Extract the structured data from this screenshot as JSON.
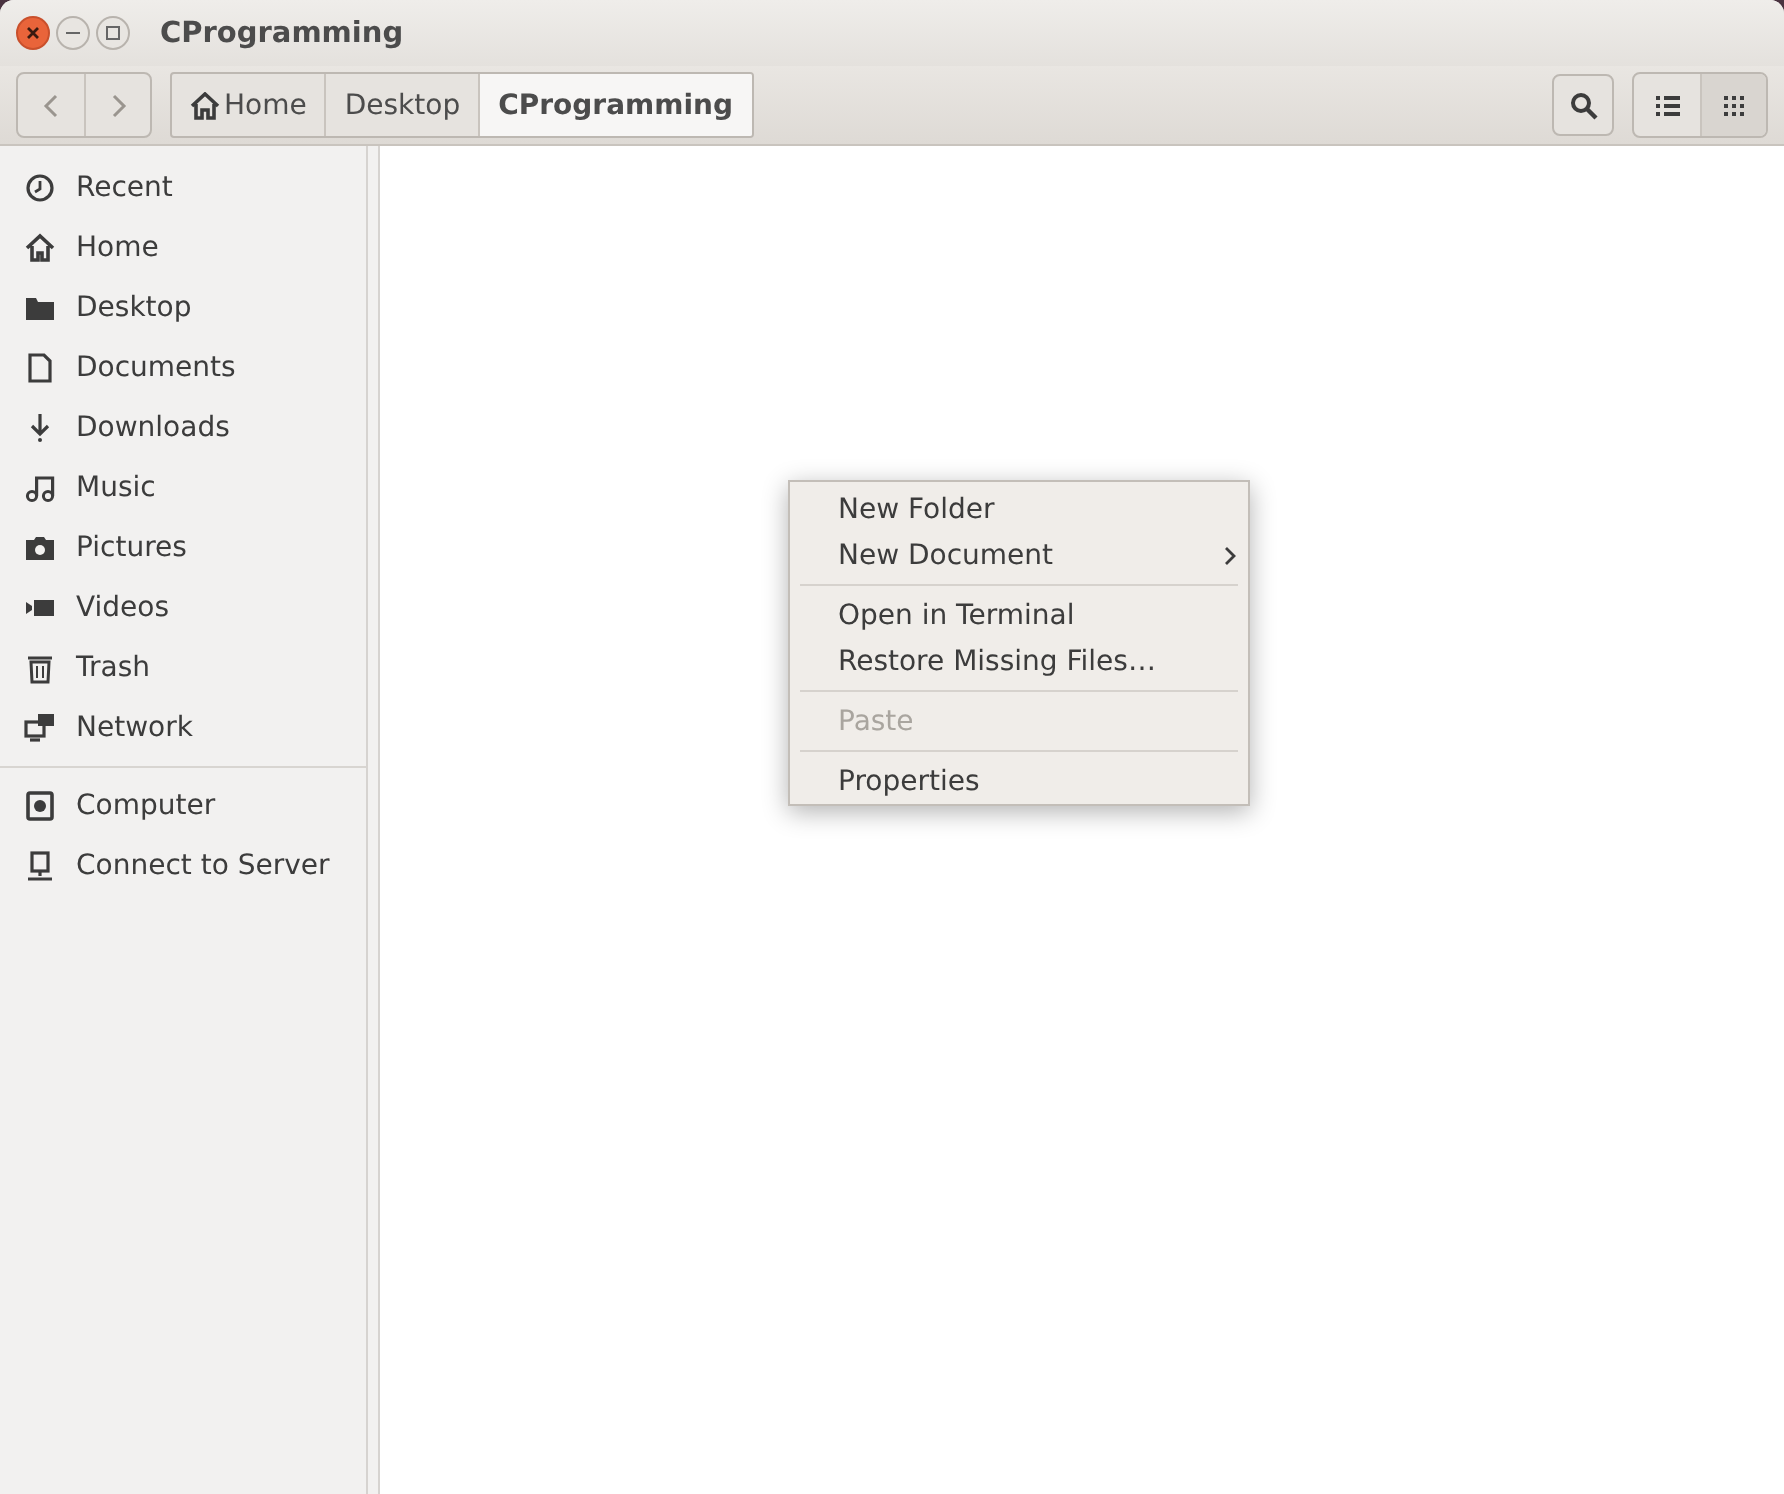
{
  "window": {
    "title": "CProgramming"
  },
  "toolbar": {
    "breadcrumbs": [
      {
        "label": "Home",
        "selected": false
      },
      {
        "label": "Desktop",
        "selected": false
      },
      {
        "label": "CProgramming",
        "selected": true
      }
    ],
    "view_buttons": [
      {
        "kind": "list",
        "selected": false
      },
      {
        "kind": "grid",
        "selected": true
      }
    ]
  },
  "sidebar": {
    "groups": [
      {
        "items": [
          {
            "label": "Recent"
          },
          {
            "label": "Home"
          },
          {
            "label": "Desktop"
          },
          {
            "label": "Documents"
          },
          {
            "label": "Downloads"
          },
          {
            "label": "Music"
          },
          {
            "label": "Pictures"
          },
          {
            "label": "Videos"
          },
          {
            "label": "Trash"
          },
          {
            "label": "Network"
          }
        ]
      },
      {
        "items": [
          {
            "label": "Computer"
          },
          {
            "label": "Connect to Server"
          }
        ]
      }
    ]
  },
  "context_menu": {
    "groups": [
      {
        "items": [
          {
            "label": "New Folder",
            "disabled": false,
            "submenu": false
          },
          {
            "label": "New Document",
            "disabled": false,
            "submenu": true
          }
        ]
      },
      {
        "items": [
          {
            "label": "Open in Terminal",
            "disabled": false,
            "submenu": false
          },
          {
            "label": "Restore Missing Files…",
            "disabled": false,
            "submenu": false
          }
        ]
      },
      {
        "items": [
          {
            "label": "Paste",
            "disabled": true,
            "submenu": false
          }
        ]
      },
      {
        "items": [
          {
            "label": "Properties",
            "disabled": false,
            "submenu": false
          }
        ]
      }
    ]
  }
}
